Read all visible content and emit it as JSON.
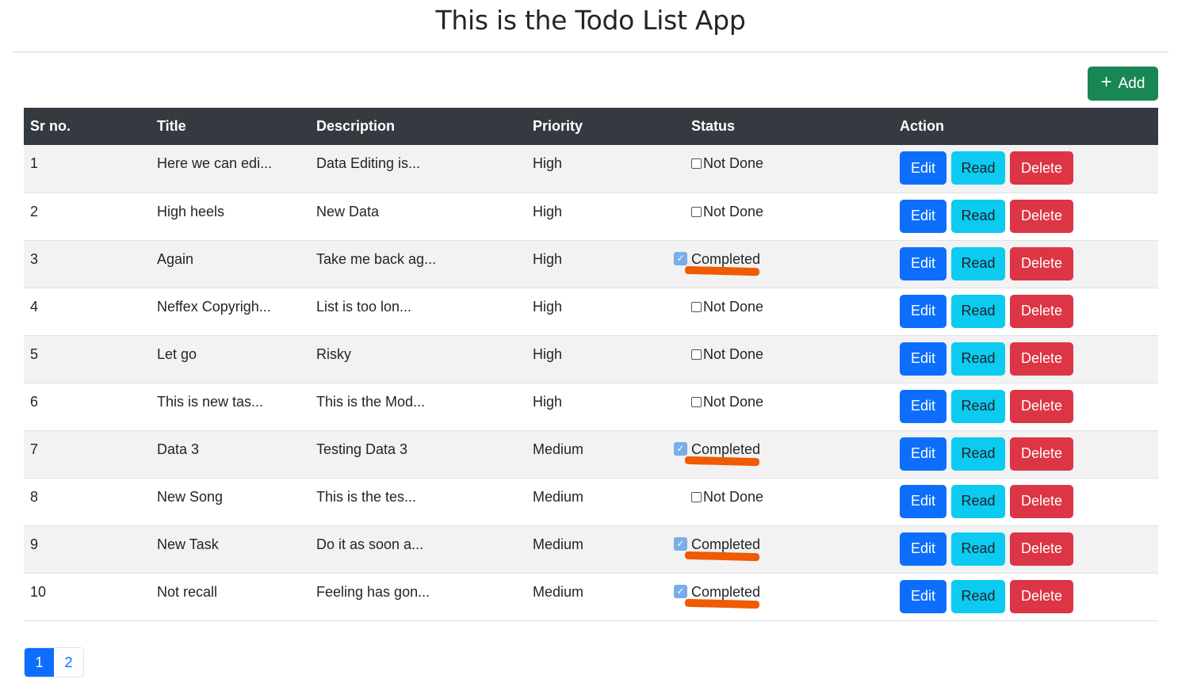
{
  "app": {
    "title": "This is the Todo List App"
  },
  "toolbar": {
    "add_label": "Add"
  },
  "table": {
    "headers": [
      "Sr no.",
      "Title",
      "Description",
      "Priority",
      "Status",
      "Action"
    ],
    "rows": [
      {
        "sr": "1",
        "title": "Here we can edi...",
        "description": "Data Editing is...",
        "priority": "High",
        "status": "Not Done"
      },
      {
        "sr": "2",
        "title": "High heels",
        "description": "New Data",
        "priority": "High",
        "status": "Not Done"
      },
      {
        "sr": "3",
        "title": "Again",
        "description": "Take me back ag...",
        "priority": "High",
        "status": "Completed"
      },
      {
        "sr": "4",
        "title": "Neffex Copyrigh...",
        "description": "List is too lon...",
        "priority": "High",
        "status": "Not Done"
      },
      {
        "sr": "5",
        "title": "Let go",
        "description": "Risky",
        "priority": "High",
        "status": "Not Done"
      },
      {
        "sr": "6",
        "title": "This is new tas...",
        "description": "This is the Mod...",
        "priority": "High",
        "status": "Not Done"
      },
      {
        "sr": "7",
        "title": "Data 3",
        "description": "Testing Data 3",
        "priority": "Medium",
        "status": "Completed"
      },
      {
        "sr": "8",
        "title": "New Song",
        "description": "This is the tes...",
        "priority": "Medium",
        "status": "Not Done"
      },
      {
        "sr": "9",
        "title": "New Task",
        "description": "Do it as soon a...",
        "priority": "Medium",
        "status": "Completed"
      },
      {
        "sr": "10",
        "title": "Not recall",
        "description": "Feeling has gon...",
        "priority": "Medium",
        "status": "Completed"
      }
    ],
    "actions": {
      "edit": "Edit",
      "read": "Read",
      "delete": "Delete"
    }
  },
  "pagination": {
    "pages": [
      "1",
      "2"
    ],
    "current": "1"
  },
  "colors": {
    "header_bg": "#343a40",
    "add": "#198754",
    "edit": "#0d6efd",
    "read": "#0dcaf0",
    "delete": "#dc3545",
    "annotation": "#f05a00"
  },
  "icons": {
    "add": "plus-icon",
    "checked": "checkbox-checked-icon",
    "unchecked": "checkbox-unchecked-icon"
  }
}
